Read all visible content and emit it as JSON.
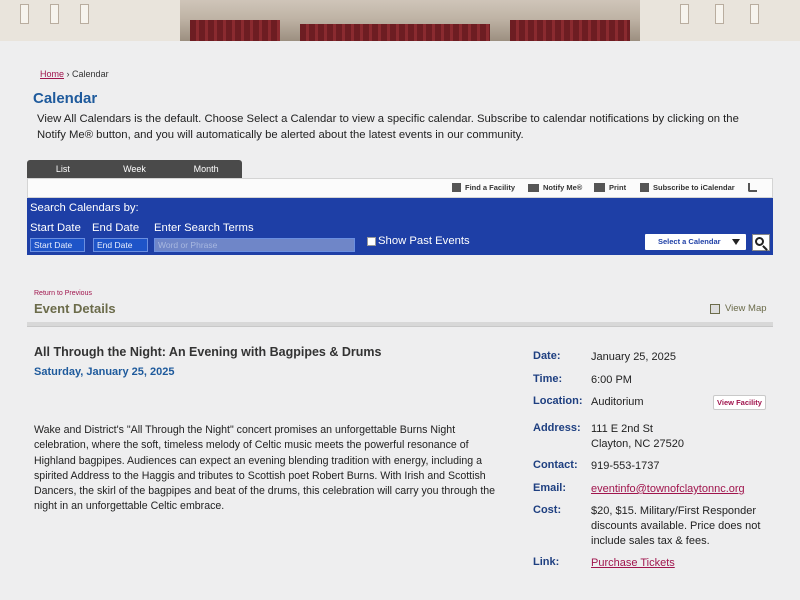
{
  "breadcrumb": {
    "home": "Home",
    "separator": "›",
    "current": "Calendar"
  },
  "page_title": "Calendar",
  "intro": "View All Calendars is the default. Choose Select a Calendar to view a specific calendar. Subscribe to calendar notifications by clicking on the Notify Me® button, and you will automatically be alerted about the latest events in our community.",
  "tabs": [
    "List",
    "Week",
    "Month"
  ],
  "toolbar": {
    "find_facility": "Find a Facility",
    "notify_me": "Notify Me®",
    "print": "Print",
    "subscribe": "Subscribe to iCalendar"
  },
  "search": {
    "heading": "Search Calendars by:",
    "start_label": "Start Date",
    "end_label": "End Date",
    "terms_label": "Enter Search Terms",
    "start_placeholder": "Start Date",
    "end_placeholder": "End Date",
    "terms_placeholder": "Word or Phrase",
    "show_past": "Show Past Events",
    "select_calendar": "Select a Calendar"
  },
  "return_link": "Return to Previous",
  "details_heading": "Event Details",
  "view_map": "View Map",
  "event": {
    "title": "All Through the Night: An Evening with Bagpipes & Drums",
    "date_long": "Saturday, January 25, 2025",
    "description": "Wake and District's \"All Through the Night\" concert promises an unforgettable Burns Night celebration, where the soft, timeless melody of Celtic music meets the powerful resonance of Highland bagpipes. Audiences can expect an evening blending tradition with energy, including a spirited Address to the Haggis and tributes to Scottish poet Robert Burns. With Irish and Scottish Dancers, the skirl of the bagpipes and beat of the drums, this celebration will carry you through the night in an unforgettable Celtic embrace."
  },
  "info": {
    "date_label": "Date:",
    "date": "January 25, 2025",
    "time_label": "Time:",
    "time": "6:00 PM",
    "location_label": "Location:",
    "location": "Auditorium",
    "view_facility": "View Facility",
    "address_label": "Address:",
    "address_line1": "111 E 2nd St",
    "address_line2": "Clayton, NC 27520",
    "contact_label": "Contact:",
    "contact": "919-553-1737",
    "email_label": "Email:",
    "email": "eventinfo@townofclaytonnc.org",
    "cost_label": "Cost:",
    "cost": "$20, $15. Military/First Responder discounts available. Price does not include sales tax & fees.",
    "link_label": "Link:",
    "link": "Purchase Tickets"
  }
}
